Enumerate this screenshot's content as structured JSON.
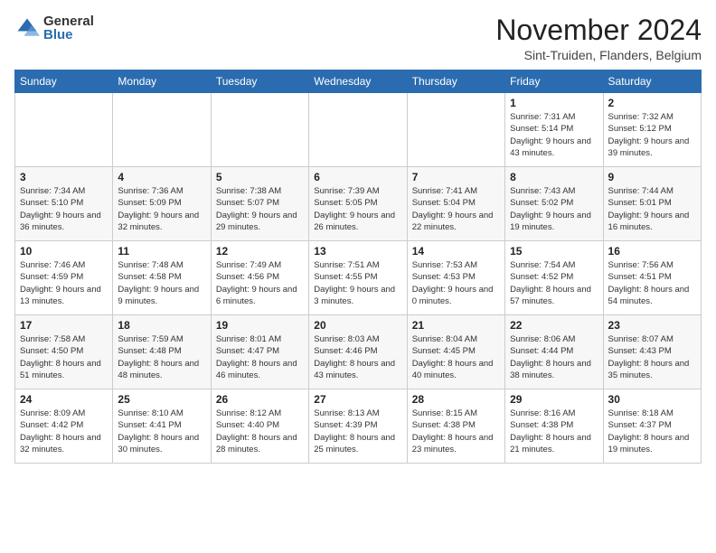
{
  "logo": {
    "general": "General",
    "blue": "Blue"
  },
  "header": {
    "month": "November 2024",
    "location": "Sint-Truiden, Flanders, Belgium"
  },
  "weekdays": [
    "Sunday",
    "Monday",
    "Tuesday",
    "Wednesday",
    "Thursday",
    "Friday",
    "Saturday"
  ],
  "weeks": [
    [
      {
        "day": "",
        "info": ""
      },
      {
        "day": "",
        "info": ""
      },
      {
        "day": "",
        "info": ""
      },
      {
        "day": "",
        "info": ""
      },
      {
        "day": "",
        "info": ""
      },
      {
        "day": "1",
        "info": "Sunrise: 7:31 AM\nSunset: 5:14 PM\nDaylight: 9 hours and 43 minutes."
      },
      {
        "day": "2",
        "info": "Sunrise: 7:32 AM\nSunset: 5:12 PM\nDaylight: 9 hours and 39 minutes."
      }
    ],
    [
      {
        "day": "3",
        "info": "Sunrise: 7:34 AM\nSunset: 5:10 PM\nDaylight: 9 hours and 36 minutes."
      },
      {
        "day": "4",
        "info": "Sunrise: 7:36 AM\nSunset: 5:09 PM\nDaylight: 9 hours and 32 minutes."
      },
      {
        "day": "5",
        "info": "Sunrise: 7:38 AM\nSunset: 5:07 PM\nDaylight: 9 hours and 29 minutes."
      },
      {
        "day": "6",
        "info": "Sunrise: 7:39 AM\nSunset: 5:05 PM\nDaylight: 9 hours and 26 minutes."
      },
      {
        "day": "7",
        "info": "Sunrise: 7:41 AM\nSunset: 5:04 PM\nDaylight: 9 hours and 22 minutes."
      },
      {
        "day": "8",
        "info": "Sunrise: 7:43 AM\nSunset: 5:02 PM\nDaylight: 9 hours and 19 minutes."
      },
      {
        "day": "9",
        "info": "Sunrise: 7:44 AM\nSunset: 5:01 PM\nDaylight: 9 hours and 16 minutes."
      }
    ],
    [
      {
        "day": "10",
        "info": "Sunrise: 7:46 AM\nSunset: 4:59 PM\nDaylight: 9 hours and 13 minutes."
      },
      {
        "day": "11",
        "info": "Sunrise: 7:48 AM\nSunset: 4:58 PM\nDaylight: 9 hours and 9 minutes."
      },
      {
        "day": "12",
        "info": "Sunrise: 7:49 AM\nSunset: 4:56 PM\nDaylight: 9 hours and 6 minutes."
      },
      {
        "day": "13",
        "info": "Sunrise: 7:51 AM\nSunset: 4:55 PM\nDaylight: 9 hours and 3 minutes."
      },
      {
        "day": "14",
        "info": "Sunrise: 7:53 AM\nSunset: 4:53 PM\nDaylight: 9 hours and 0 minutes."
      },
      {
        "day": "15",
        "info": "Sunrise: 7:54 AM\nSunset: 4:52 PM\nDaylight: 8 hours and 57 minutes."
      },
      {
        "day": "16",
        "info": "Sunrise: 7:56 AM\nSunset: 4:51 PM\nDaylight: 8 hours and 54 minutes."
      }
    ],
    [
      {
        "day": "17",
        "info": "Sunrise: 7:58 AM\nSunset: 4:50 PM\nDaylight: 8 hours and 51 minutes."
      },
      {
        "day": "18",
        "info": "Sunrise: 7:59 AM\nSunset: 4:48 PM\nDaylight: 8 hours and 48 minutes."
      },
      {
        "day": "19",
        "info": "Sunrise: 8:01 AM\nSunset: 4:47 PM\nDaylight: 8 hours and 46 minutes."
      },
      {
        "day": "20",
        "info": "Sunrise: 8:03 AM\nSunset: 4:46 PM\nDaylight: 8 hours and 43 minutes."
      },
      {
        "day": "21",
        "info": "Sunrise: 8:04 AM\nSunset: 4:45 PM\nDaylight: 8 hours and 40 minutes."
      },
      {
        "day": "22",
        "info": "Sunrise: 8:06 AM\nSunset: 4:44 PM\nDaylight: 8 hours and 38 minutes."
      },
      {
        "day": "23",
        "info": "Sunrise: 8:07 AM\nSunset: 4:43 PM\nDaylight: 8 hours and 35 minutes."
      }
    ],
    [
      {
        "day": "24",
        "info": "Sunrise: 8:09 AM\nSunset: 4:42 PM\nDaylight: 8 hours and 32 minutes."
      },
      {
        "day": "25",
        "info": "Sunrise: 8:10 AM\nSunset: 4:41 PM\nDaylight: 8 hours and 30 minutes."
      },
      {
        "day": "26",
        "info": "Sunrise: 8:12 AM\nSunset: 4:40 PM\nDaylight: 8 hours and 28 minutes."
      },
      {
        "day": "27",
        "info": "Sunrise: 8:13 AM\nSunset: 4:39 PM\nDaylight: 8 hours and 25 minutes."
      },
      {
        "day": "28",
        "info": "Sunrise: 8:15 AM\nSunset: 4:38 PM\nDaylight: 8 hours and 23 minutes."
      },
      {
        "day": "29",
        "info": "Sunrise: 8:16 AM\nSunset: 4:38 PM\nDaylight: 8 hours and 21 minutes."
      },
      {
        "day": "30",
        "info": "Sunrise: 8:18 AM\nSunset: 4:37 PM\nDaylight: 8 hours and 19 minutes."
      }
    ]
  ]
}
